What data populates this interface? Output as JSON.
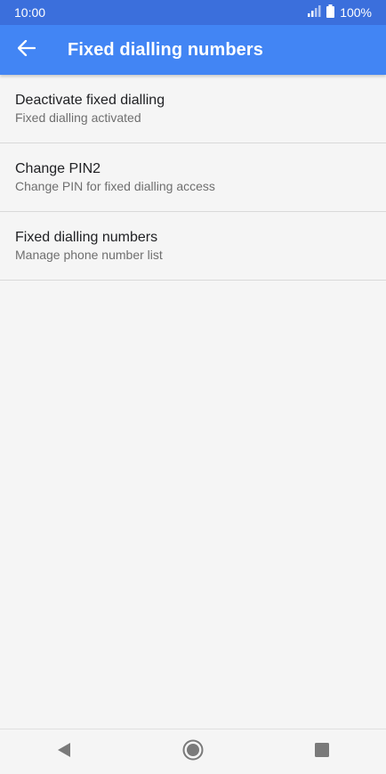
{
  "status_bar": {
    "time": "10:00",
    "battery_text": "100%",
    "icons": [
      "signal-icon",
      "battery-icon"
    ]
  },
  "app_bar": {
    "title": "Fixed dialling numbers",
    "back_icon": "arrow-left-icon"
  },
  "list": [
    {
      "title": "Deactivate fixed dialling",
      "subtitle": "Fixed dialling activated"
    },
    {
      "title": "Change PIN2",
      "subtitle": "Change PIN for fixed dialling access"
    },
    {
      "title": "Fixed dialling numbers",
      "subtitle": "Manage phone number list"
    }
  ],
  "nav_bar": {
    "icons": [
      "back-triangle-icon",
      "home-circle-icon",
      "recents-square-icon"
    ]
  },
  "colors": {
    "status_bar": "#3b6fdc",
    "app_bar": "#4285f4",
    "background": "#f5f5f5",
    "title_text": "#202124",
    "subtitle_text": "#6f6f6f"
  }
}
